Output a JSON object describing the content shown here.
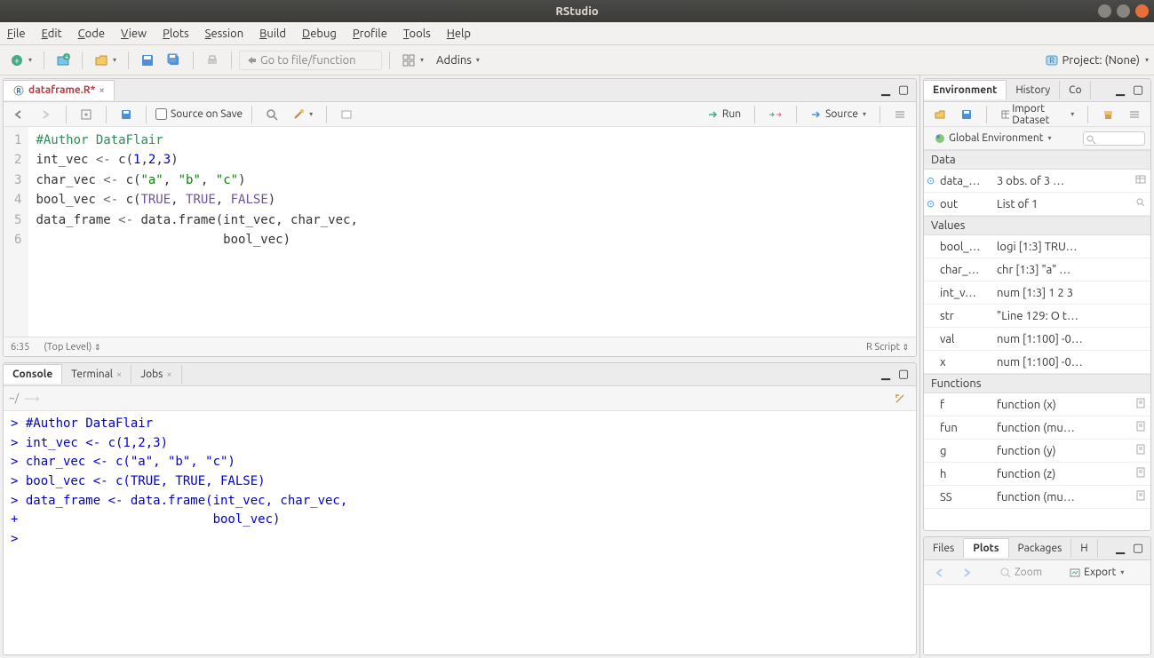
{
  "window": {
    "title": "RStudio"
  },
  "menubar": [
    "File",
    "Edit",
    "Code",
    "View",
    "Plots",
    "Session",
    "Build",
    "Debug",
    "Profile",
    "Tools",
    "Help"
  ],
  "maintoolbar": {
    "goto_placeholder": "Go to file/function",
    "addins_label": "Addins",
    "project_label": "Project: (None)"
  },
  "editor": {
    "tab_title": "dataframe.R*",
    "source_on_save": "Source on Save",
    "run_label": "Run",
    "source_label": "Source",
    "cursor_pos": "6:35",
    "scope": "(Top Level)",
    "mode": "R Script",
    "lines": [
      {
        "n": "1",
        "html": "<span class='c-comment'>#Author DataFlair</span>"
      },
      {
        "n": "2",
        "html": "int_vec <span class='c-op'>&lt;-</span> c(<span class='c-num'>1</span>,<span class='c-num'>2</span>,<span class='c-num'>3</span>)"
      },
      {
        "n": "3",
        "html": "char_vec <span class='c-op'>&lt;-</span> c(<span class='c-str'>\"a\"</span>, <span class='c-str'>\"b\"</span>, <span class='c-str'>\"c\"</span>)"
      },
      {
        "n": "4",
        "html": "bool_vec <span class='c-op'>&lt;-</span> c(<span class='c-const'>TRUE</span>, <span class='c-const'>TRUE</span>, <span class='c-const'>FALSE</span>)"
      },
      {
        "n": "5",
        "html": "data_frame <span class='c-op'>&lt;-</span> data.frame(int_vec, char_vec,"
      },
      {
        "n": "6",
        "html": "                         bool_vec)"
      }
    ]
  },
  "console": {
    "tabs": [
      "Console",
      "Terminal",
      "Jobs"
    ],
    "cwd": "~/",
    "lines": [
      "<span class='c-blue'>&gt; #Author DataFlair</span>",
      "<span class='c-blue'>&gt; int_vec &lt;- c(1,2,3)</span>",
      "<span class='c-blue'>&gt; char_vec &lt;- c(\"a\", \"b\", \"c\")</span>",
      "<span class='c-blue'>&gt; bool_vec &lt;- c(TRUE, TRUE, FALSE)</span>",
      "<span class='c-blue'>&gt; data_frame &lt;- data.frame(int_vec, char_vec,</span>",
      "<span class='c-blue'>+                          bool_vec)</span>",
      "<span class='c-blue'>&gt; </span>"
    ]
  },
  "env_pane": {
    "tabs": [
      "Environment",
      "History",
      "Co"
    ],
    "import_label": "Import Dataset",
    "scope": "Global Environment",
    "search_placeholder": "",
    "sections": [
      {
        "title": "Data",
        "rows": [
          {
            "icon": "⊙",
            "name": "data_…",
            "val": "3 obs. of 3 …",
            "act": "grid"
          },
          {
            "icon": "⊙",
            "name": "out",
            "val": "List of 1",
            "act": "search"
          }
        ]
      },
      {
        "title": "Values",
        "rows": [
          {
            "name": "bool_…",
            "val": "logi [1:3] TRU…"
          },
          {
            "name": "char_…",
            "val": "chr [1:3] \"a\" …"
          },
          {
            "name": "int_v…",
            "val": "num [1:3] 1 2 3"
          },
          {
            "name": "str",
            "val": "\"Line 129: O t…"
          },
          {
            "name": "val",
            "val": "num [1:100] -0…"
          },
          {
            "name": "x",
            "val": "num [1:100] -0…"
          }
        ]
      },
      {
        "title": "Functions",
        "rows": [
          {
            "name": "f",
            "val": "function (x)",
            "act": "doc"
          },
          {
            "name": "fun",
            "val": "function (mu…",
            "act": "doc"
          },
          {
            "name": "g",
            "val": "function (y)",
            "act": "doc"
          },
          {
            "name": "h",
            "val": "function (z)",
            "act": "doc"
          },
          {
            "name": "SS",
            "val": "function (mu…",
            "act": "doc"
          }
        ]
      }
    ]
  },
  "plots_pane": {
    "tabs": [
      "Files",
      "Plots",
      "Packages",
      "H"
    ],
    "zoom_label": "Zoom",
    "export_label": "Export"
  }
}
